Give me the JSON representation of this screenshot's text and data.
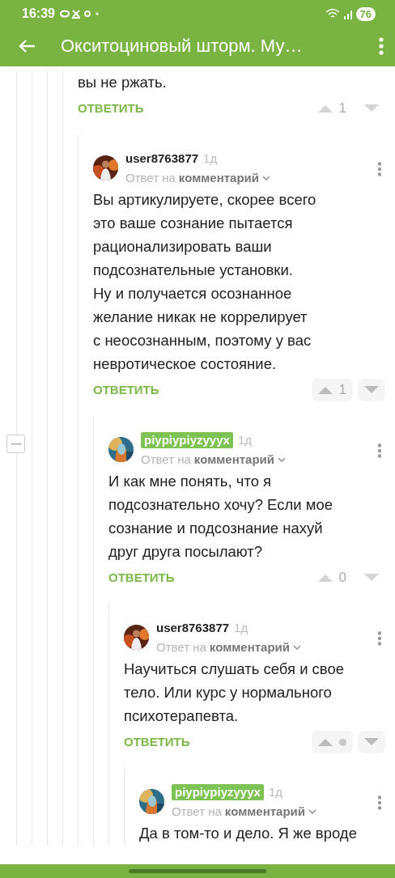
{
  "status_bar": {
    "time": "16:39",
    "battery": "76"
  },
  "app_bar": {
    "title": "Окситоциновый шторм. Му…"
  },
  "comments": [
    {
      "body": "вы не ржать.",
      "reply_label": "ОТВЕТИТЬ",
      "rating": "1",
      "rating_hidden": false,
      "votes_highlighted": false,
      "children": [
        {
          "author": "user8763877",
          "author_highlighted": false,
          "time": "1д",
          "reply_prefix": "Ответ на",
          "reply_target": "комментарий",
          "body": "Вы артикулируете, скорее всего\nэто ваше сознание пытается\nрационализировать ваши\nподсознательные установки.\nНу и получается осознанное\nжелание никак не коррелирует\nс неосознанным, поэтому у вас\nневротическое состояние.",
          "reply_label": "ОТВЕТИТЬ",
          "rating": "1",
          "rating_hidden": false,
          "votes_highlighted": true,
          "children": [
            {
              "author": "piypiypiyzyyyx",
              "author_highlighted": true,
              "time": "1д",
              "reply_prefix": "Ответ на",
              "reply_target": "комментарий",
              "body": "И как мне понять, что я\nподсознательно хочу? Если мое\nсознание и подсознание нахуй\nдруг друга посылают?",
              "reply_label": "ОТВЕТИТЬ",
              "rating": "0",
              "rating_hidden": false,
              "votes_highlighted": false,
              "collapsible": true,
              "children": [
                {
                  "author": "user8763877",
                  "author_highlighted": false,
                  "time": "1д",
                  "reply_prefix": "Ответ на",
                  "reply_target": "комментарий",
                  "body": "Научиться слушать себя и свое\nтело. Или курс у нормального\nпсихотерапевта.",
                  "reply_label": "ОТВЕТИТЬ",
                  "rating_hidden": true,
                  "votes_highlighted": true,
                  "children": [
                    {
                      "author": "piypiypiyzyyyx",
                      "author_highlighted": true,
                      "time": "1д",
                      "reply_prefix": "Ответ на",
                      "reply_target": "комментарий",
                      "body": "Да в том-то и дело. Я же вроде"
                    }
                  ]
                }
              ]
            }
          ]
        }
      ]
    }
  ]
}
